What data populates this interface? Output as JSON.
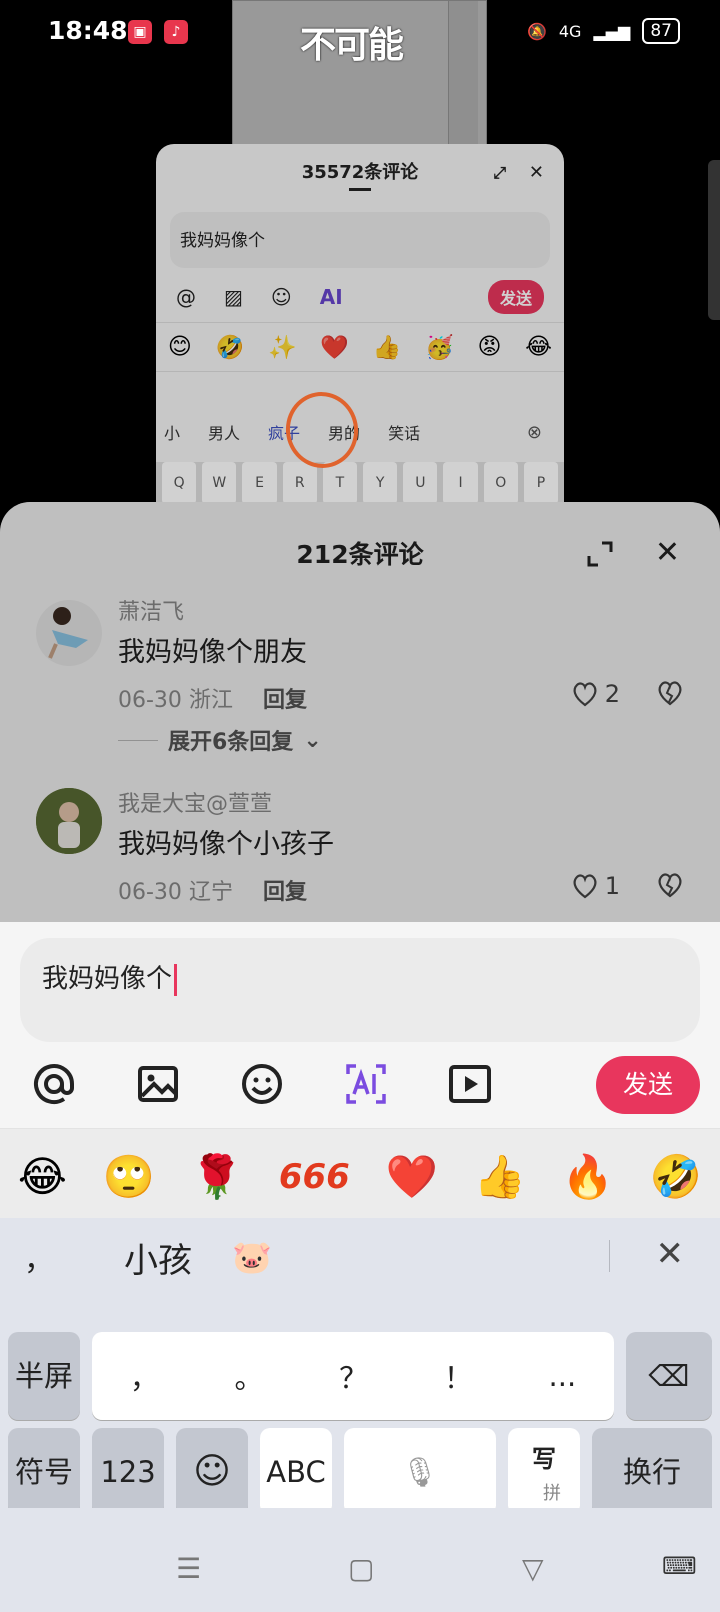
{
  "status_bar": {
    "time": "18:48",
    "network": "4G",
    "battery": "87"
  },
  "overlay_logo": "不可能",
  "background_panel": {
    "title": "35572条评论",
    "input_text": "我妈妈像个",
    "send_label": "发送",
    "emojis": [
      "😊",
      "🤣",
      "✨",
      "❤️",
      "👍",
      "🥳",
      "😡",
      "😂"
    ],
    "candidates": [
      "小",
      "男人",
      "疯子",
      "男的",
      "笑话"
    ],
    "keys": [
      "Q",
      "W",
      "E",
      "R",
      "T",
      "Y",
      "U",
      "I",
      "O",
      "P"
    ]
  },
  "sheet": {
    "title": "212条评论",
    "comments": [
      {
        "user": "萧洁飞",
        "text": "我妈妈像个朋友",
        "date": "06-30",
        "location": "浙江",
        "reply_label": "回复",
        "likes": "2",
        "expand_label": "展开6条回复"
      },
      {
        "user": "我是大宝@萱萱",
        "text": "我妈妈像个小孩子",
        "date": "06-30",
        "location": "辽宁",
        "reply_label": "回复",
        "likes": "1"
      }
    ]
  },
  "compose": {
    "input_text": "我妈妈像个",
    "send_label": "发送",
    "emojis": [
      "😂",
      "🙄",
      "🌹",
      "666",
      "❤️",
      "👍",
      "🔥",
      "🤣"
    ]
  },
  "keyboard": {
    "candidates": {
      "comma": "，",
      "word": "小孩",
      "emoji": "🐷"
    },
    "row_punct": {
      "left": "半屏",
      "keys": [
        "，",
        "。",
        "？",
        "！",
        "..."
      ]
    },
    "row_bottom": {
      "symbols": "符号",
      "numbers": "123",
      "abc": "ABC",
      "handwrite": "写",
      "handwrite_sub": "拼",
      "enter": "换行"
    }
  },
  "colors": {
    "accent": "#e8365d",
    "ai_purple": "#7b4ce0"
  }
}
